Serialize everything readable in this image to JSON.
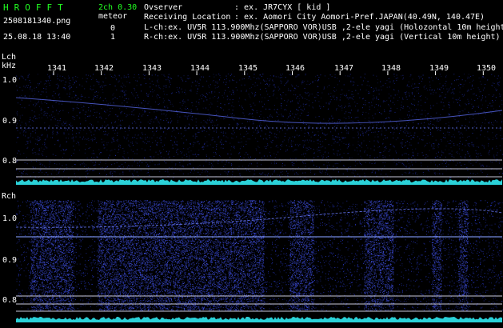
{
  "app": {
    "brand": "HROFFT",
    "mode": "2ch 0.30",
    "category": "meteor"
  },
  "file": {
    "name": "2508181340.png",
    "datetime": "25.08.18 13:40"
  },
  "counts": {
    "lch": "0",
    "rch": "1"
  },
  "header": {
    "observer_label": "Ovserver",
    "observer_value": ": ex. JR7CYX [ kid ]",
    "location_label": "Receiving Location",
    "location_value": ": ex. Aomori City Aomori-Pref.JAPAN(40.49N, 140.47E)",
    "lch_line": "L-ch:ex. UV5R 113.900Mhz(SAPPORO VOR)USB ,2-ele yagi (Holozontal 10m height)",
    "rch_line": "R-ch:ex. UV5R 113.900Mhz(SAPPORO VOR)USB ,2-ele yagi (Vertical 10m height)"
  },
  "panels": {
    "lch_label": "Lch",
    "unit_label": "kHz",
    "rch_label": "Rch"
  },
  "x_ticks": [
    "1341",
    "1342",
    "1343",
    "1344",
    "1345",
    "1346",
    "1347",
    "1348",
    "1349",
    "1350"
  ],
  "y_ticks": [
    "1.0",
    "0.9",
    "0.8"
  ],
  "colors": {
    "background": "#000000",
    "title_green": "#22ff22",
    "noise_blue": "#2838c8",
    "trace_cyan": "#30e8f0"
  }
}
